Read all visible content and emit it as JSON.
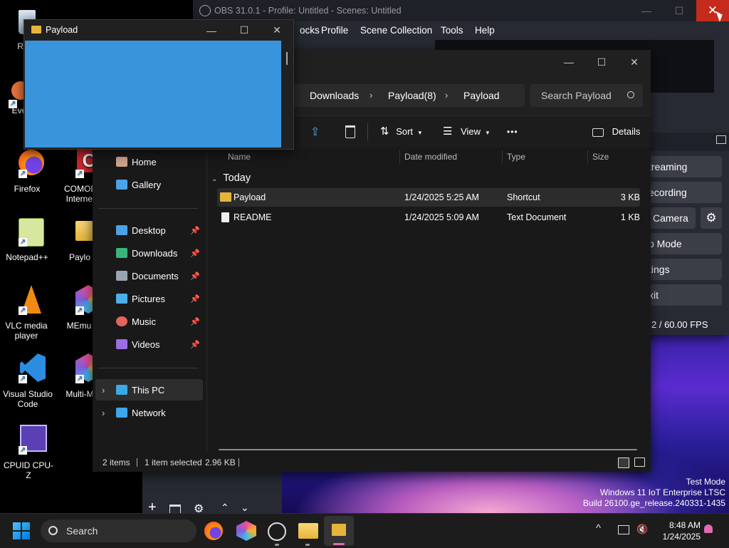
{
  "desktop": {
    "icons": [
      {
        "label": "Recy",
        "name": "recycle-bin"
      },
      {
        "label": "Ever",
        "name": "everything"
      },
      {
        "label": "Firefox",
        "name": "firefox"
      },
      {
        "label": "COMOD Internet",
        "name": "comodo"
      },
      {
        "label": "Notepad++",
        "name": "notepad-plus-plus"
      },
      {
        "label": "Paylo",
        "name": "payload-folder"
      },
      {
        "label": "VLC media player",
        "name": "vlc"
      },
      {
        "label": "MEmu",
        "name": "memu"
      },
      {
        "label": "Visual Studio Code",
        "name": "vscode"
      },
      {
        "label": "Multi-ME",
        "name": "multi-memu"
      },
      {
        "label": "CPUID CPU-Z",
        "name": "cpu-z"
      }
    ],
    "watermark": {
      "line1": "Test Mode",
      "line2": "Windows 11 IoT Enterprise LTSC",
      "line3": "Build 26100.ge_release.240331-1435"
    }
  },
  "obs": {
    "title": "OBS 31.0.1 - Profile: Untitled - Scenes: Untitled",
    "menu": [
      "ocks",
      "Profile",
      "Scene Collection",
      "Tools",
      "Help"
    ],
    "controls": [
      "treaming",
      "ecording",
      "Camera",
      "o Mode",
      "tings",
      "xit"
    ],
    "fps": "2 / 60.00 FPS"
  },
  "payload_window": {
    "title": "Payload",
    "preview_color": "#3a94dc"
  },
  "explorer": {
    "breadcrumb": [
      "Downloads",
      "Payload(8)",
      "Payload"
    ],
    "search_placeholder": "Search Payload",
    "toolbar": {
      "sort": "Sort",
      "view": "View",
      "more": "•••",
      "details": "Details"
    },
    "sidebar": {
      "top": [
        {
          "label": "Home"
        },
        {
          "label": "Gallery"
        }
      ],
      "pinned": [
        {
          "label": "Desktop",
          "color": "#4aa3e8"
        },
        {
          "label": "Downloads",
          "color": "#39b57a"
        },
        {
          "label": "Documents",
          "color": "#9aa4b1"
        },
        {
          "label": "Pictures",
          "color": "#4ab0e8"
        },
        {
          "label": "Music",
          "color": "#e2665b"
        },
        {
          "label": "Videos",
          "color": "#9b6ee6"
        }
      ],
      "bottom": [
        {
          "label": "This PC"
        },
        {
          "label": "Network"
        }
      ]
    },
    "columns": [
      "Name",
      "Date modified",
      "Type",
      "Size"
    ],
    "group": "Today",
    "files": [
      {
        "name": "Payload",
        "date": "1/24/2025 5:25 AM",
        "type": "Shortcut",
        "size": "3 KB",
        "selected": true
      },
      {
        "name": "README",
        "date": "1/24/2025 5:09 AM",
        "type": "Text Document",
        "size": "1 KB",
        "selected": false
      }
    ],
    "status": {
      "items": "2 items",
      "selected": "1 item selected",
      "size": "2.96 KB"
    }
  },
  "taskbar": {
    "search": "Search",
    "time": "8:48 AM",
    "date": "1/24/2025"
  }
}
